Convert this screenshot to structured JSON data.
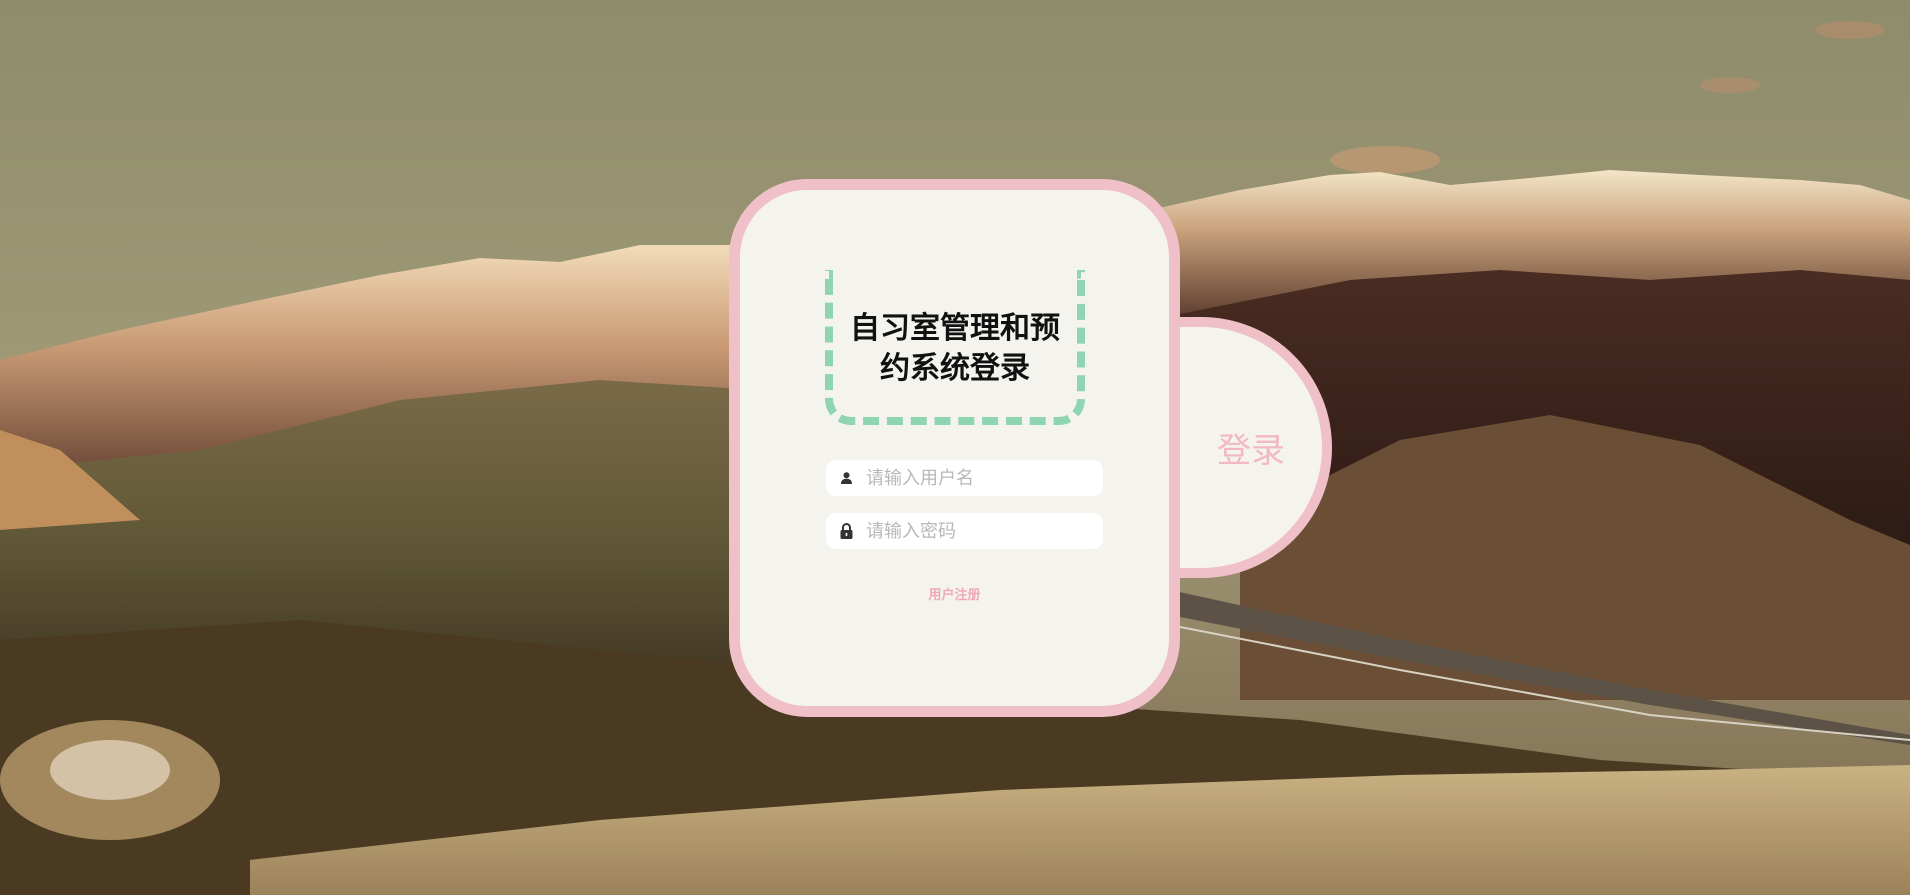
{
  "login": {
    "title": "自习室管理和预约系统登录",
    "username_placeholder": "请输入用户名",
    "password_placeholder": "请输入密码",
    "register_link": "用户注册",
    "login_button": "登录"
  },
  "icons": {
    "username": "user-icon",
    "password": "lock-icon"
  },
  "colors": {
    "card_background": "#f4f3ee",
    "card_border": "#f0c0c9",
    "title_dashed_border": "#8fd5b2",
    "login_label": "#f2b8c4",
    "register_link": "#f0a8b8"
  }
}
